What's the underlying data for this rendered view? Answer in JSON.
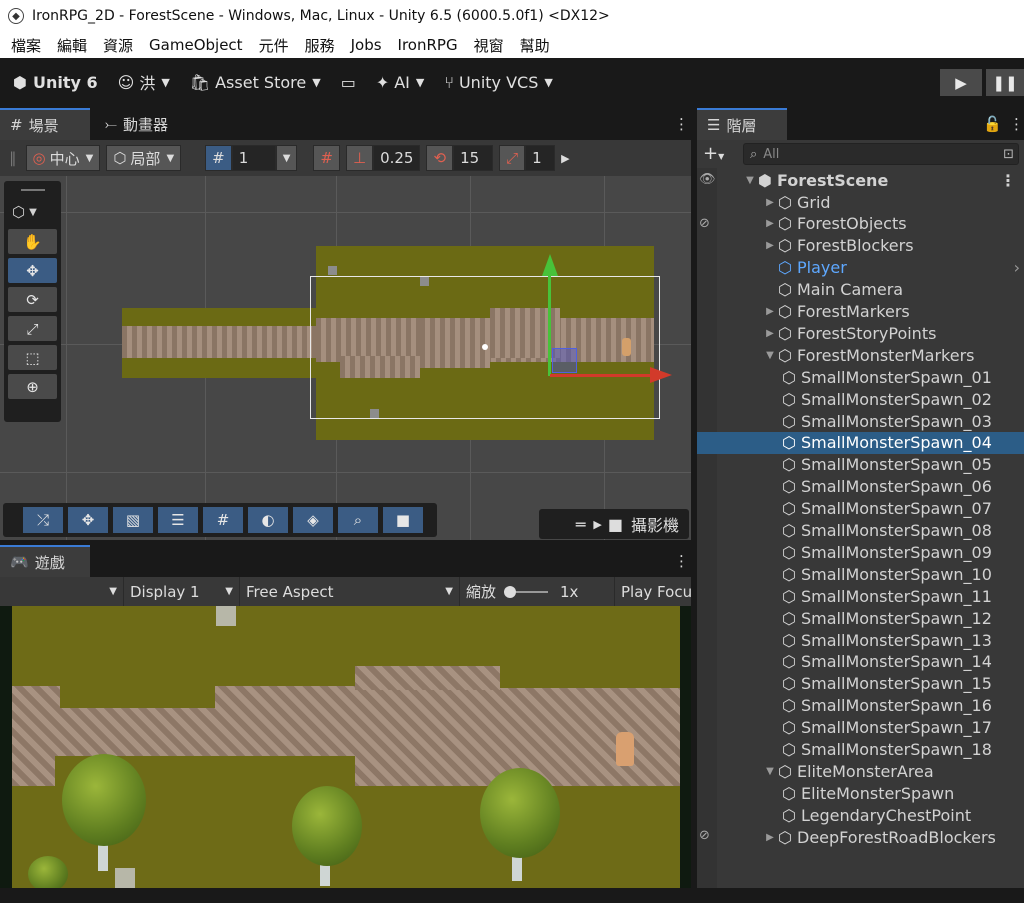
{
  "window": {
    "title": "IronRPG_2D - ForestScene - Windows, Mac, Linux - Unity 6.5 (6000.5.0f1) <DX12>"
  },
  "menu": [
    "檔案",
    "編輯",
    "資源",
    "GameObject",
    "元件",
    "服務",
    "Jobs",
    "IronRPG",
    "視窗",
    "幫助"
  ],
  "toolbar": {
    "unity": "Unity 6",
    "account": "洪",
    "asset_store": "Asset Store",
    "ai": "AI",
    "vcs": "Unity VCS"
  },
  "scene": {
    "tab_scene": "場景",
    "tab_animator": "動畫器",
    "pivot": "中心",
    "space": "局部",
    "grid_value": "1",
    "snap_value": "0.25",
    "rotate_snap": "15",
    "scale_snap": "1",
    "camera_label": "攝影機"
  },
  "game": {
    "tab": "遊戲",
    "display": "Display 1",
    "aspect": "Free Aspect",
    "scale_label": "縮放",
    "scale_value": "1x",
    "play_focus": "Play Focu"
  },
  "hierarchy": {
    "tab": "階層",
    "search_placeholder": "All",
    "scene": "ForestScene",
    "items": [
      {
        "label": "Grid",
        "arrow": "▶",
        "depth": 1,
        "selected": false,
        "prefab": false
      },
      {
        "label": "ForestObjects",
        "arrow": "▶",
        "depth": 1,
        "selected": false,
        "prefab": false
      },
      {
        "label": "ForestBlockers",
        "arrow": "▶",
        "depth": 1,
        "selected": false,
        "prefab": false
      },
      {
        "label": "Player",
        "arrow": "",
        "depth": 1,
        "selected": false,
        "prefab": true
      },
      {
        "label": "Main Camera",
        "arrow": "",
        "depth": 1,
        "selected": false,
        "prefab": false
      },
      {
        "label": "ForestMarkers",
        "arrow": "▶",
        "depth": 1,
        "selected": false,
        "prefab": false
      },
      {
        "label": "ForestStoryPoints",
        "arrow": "▶",
        "depth": 1,
        "selected": false,
        "prefab": false
      },
      {
        "label": "ForestMonsterMarkers",
        "arrow": "▼",
        "depth": 1,
        "selected": false,
        "prefab": false
      },
      {
        "label": "SmallMonsterSpawn_01",
        "arrow": "",
        "depth": 2,
        "selected": false,
        "prefab": false
      },
      {
        "label": "SmallMonsterSpawn_02",
        "arrow": "",
        "depth": 2,
        "selected": false,
        "prefab": false
      },
      {
        "label": "SmallMonsterSpawn_03",
        "arrow": "",
        "depth": 2,
        "selected": false,
        "prefab": false
      },
      {
        "label": "SmallMonsterSpawn_04",
        "arrow": "",
        "depth": 2,
        "selected": true,
        "prefab": false
      },
      {
        "label": "SmallMonsterSpawn_05",
        "arrow": "",
        "depth": 2,
        "selected": false,
        "prefab": false
      },
      {
        "label": "SmallMonsterSpawn_06",
        "arrow": "",
        "depth": 2,
        "selected": false,
        "prefab": false
      },
      {
        "label": "SmallMonsterSpawn_07",
        "arrow": "",
        "depth": 2,
        "selected": false,
        "prefab": false
      },
      {
        "label": "SmallMonsterSpawn_08",
        "arrow": "",
        "depth": 2,
        "selected": false,
        "prefab": false
      },
      {
        "label": "SmallMonsterSpawn_09",
        "arrow": "",
        "depth": 2,
        "selected": false,
        "prefab": false
      },
      {
        "label": "SmallMonsterSpawn_10",
        "arrow": "",
        "depth": 2,
        "selected": false,
        "prefab": false
      },
      {
        "label": "SmallMonsterSpawn_11",
        "arrow": "",
        "depth": 2,
        "selected": false,
        "prefab": false
      },
      {
        "label": "SmallMonsterSpawn_12",
        "arrow": "",
        "depth": 2,
        "selected": false,
        "prefab": false
      },
      {
        "label": "SmallMonsterSpawn_13",
        "arrow": "",
        "depth": 2,
        "selected": false,
        "prefab": false
      },
      {
        "label": "SmallMonsterSpawn_14",
        "arrow": "",
        "depth": 2,
        "selected": false,
        "prefab": false
      },
      {
        "label": "SmallMonsterSpawn_15",
        "arrow": "",
        "depth": 2,
        "selected": false,
        "prefab": false
      },
      {
        "label": "SmallMonsterSpawn_16",
        "arrow": "",
        "depth": 2,
        "selected": false,
        "prefab": false
      },
      {
        "label": "SmallMonsterSpawn_17",
        "arrow": "",
        "depth": 2,
        "selected": false,
        "prefab": false
      },
      {
        "label": "SmallMonsterSpawn_18",
        "arrow": "",
        "depth": 2,
        "selected": false,
        "prefab": false
      },
      {
        "label": "EliteMonsterArea",
        "arrow": "▼",
        "depth": 1,
        "selected": false,
        "prefab": false
      },
      {
        "label": "EliteMonsterSpawn",
        "arrow": "",
        "depth": 2,
        "selected": false,
        "prefab": false
      },
      {
        "label": "LegendaryChestPoint",
        "arrow": "",
        "depth": 2,
        "selected": false,
        "prefab": false
      },
      {
        "label": "DeepForestRoadBlockers",
        "arrow": "▶",
        "depth": 1,
        "selected": false,
        "prefab": false
      }
    ]
  },
  "colors": {
    "selection": "#2c5d87",
    "accent": "#3b5c84",
    "grass": "#6b6a14",
    "prefab_text": "#5ea8ff"
  }
}
